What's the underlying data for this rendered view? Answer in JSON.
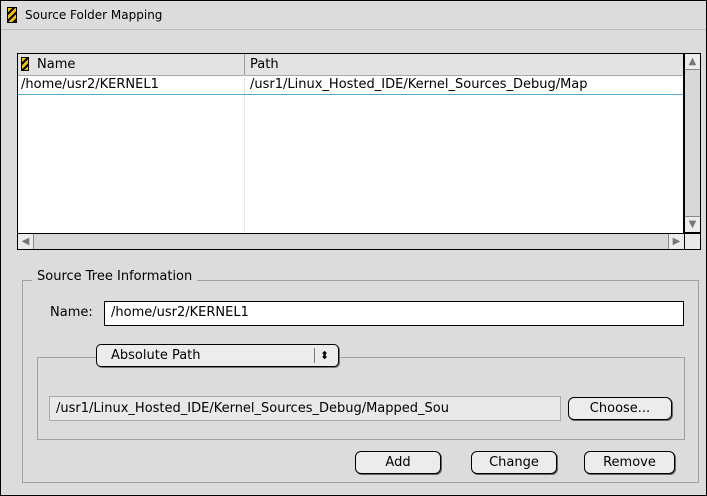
{
  "window": {
    "title": "Source Folder Mapping"
  },
  "table": {
    "columns": [
      "Name",
      "Path"
    ],
    "rows": [
      {
        "name": "/home/usr2/KERNEL1",
        "path": "/usr1/Linux_Hosted_IDE/Kernel_Sources_Debug/Map"
      }
    ]
  },
  "source_tree": {
    "group_label": "Source Tree Information",
    "name_label": "Name:",
    "name_value": "/home/usr2/KERNEL1",
    "path_type": "Absolute Path",
    "path_value": "/usr1/Linux_Hosted_IDE/Kernel_Sources_Debug/Mapped_Sou",
    "choose_label": "Choose..."
  },
  "actions": {
    "add_label": "Add",
    "change_label": "Change",
    "remove_label": "Remove"
  },
  "icons": {
    "window_grip": "grip-icon",
    "popup_arrow": "updown-arrow-icon"
  }
}
